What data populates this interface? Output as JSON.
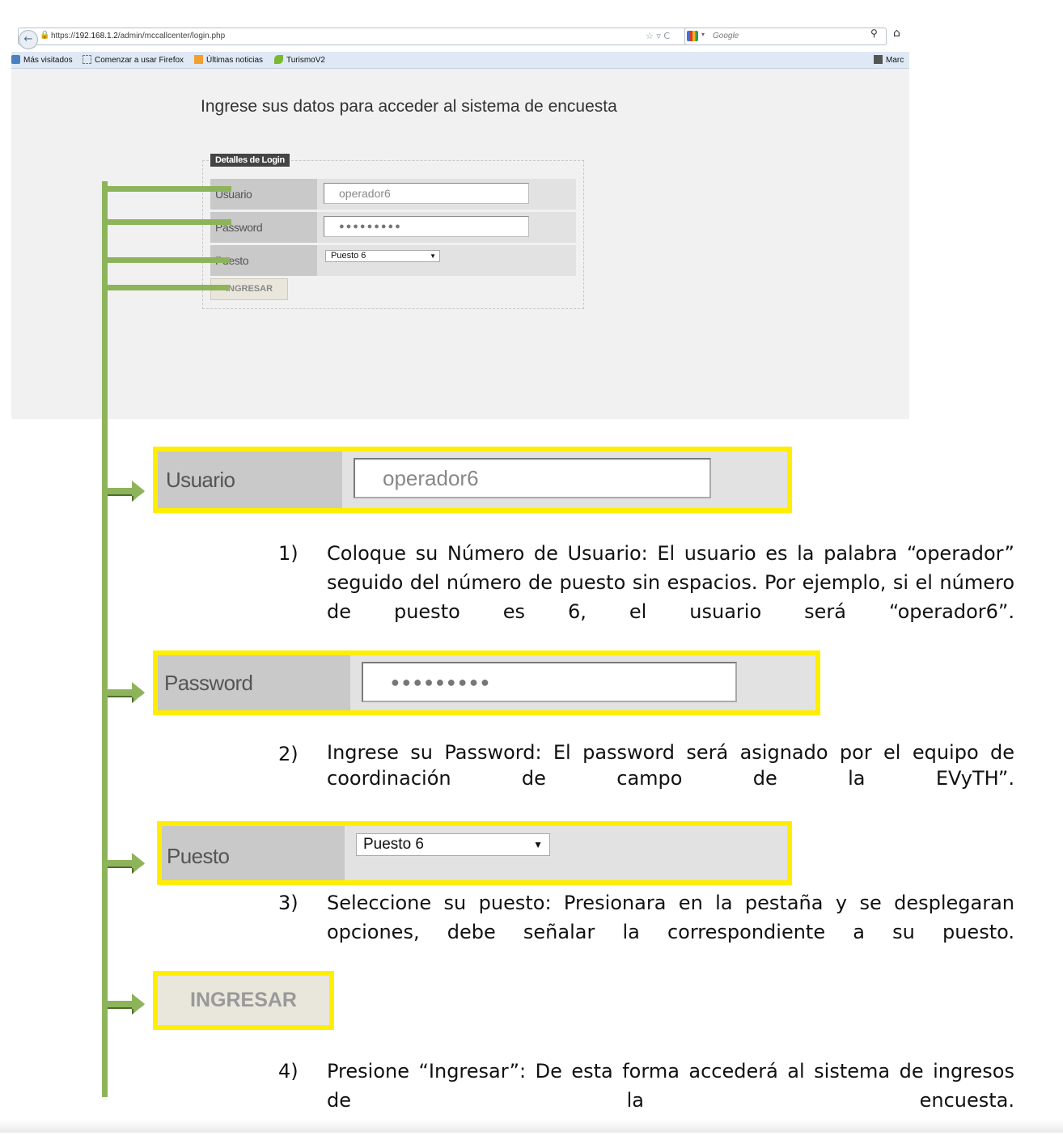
{
  "browser": {
    "url_prefix": "https://",
    "url_host": "192.168.1.2",
    "url_path": "/admin/mccallcenter/login.php",
    "search_placeholder": "Google",
    "bookmarks": [
      "Más visitados",
      "Comenzar a usar Firefox",
      "Últimas noticias",
      "TurismoV2"
    ],
    "bookmarks_right": "Marc"
  },
  "login": {
    "title": "Ingrese sus datos para acceder al sistema de encuesta",
    "legend": "Detalles de Login",
    "user_label": "Usuario",
    "user_value": "operador6",
    "password_label": "Password",
    "password_value": "●●●●●●●●●",
    "puesto_label": "Puesto",
    "puesto_value": "Puesto 6",
    "submit_label": "INGRESAR"
  },
  "steps": [
    {
      "num": "1)",
      "text": "Coloque su Número de Usuario: El usuario es la palabra “operador” seguido del número de puesto sin espacios. Por ejemplo, si el número de puesto es 6, el usuario será “operador6”."
    },
    {
      "num": "2)",
      "text": "Ingrese su Password: El password será asignado por el equipo de coordinación de campo de la EVyTH”."
    },
    {
      "num": "3)",
      "text": "Seleccione su puesto: Presionara en la pestaña y se desplegaran opciones, debe señalar la correspondiente a su puesto."
    },
    {
      "num": "4)",
      "text": "Presione “Ingresar”: De esta forma accederá al sistema de ingresos de la encuesta."
    }
  ],
  "colors": {
    "highlight": "#ffee00",
    "callout": "#8db45a"
  }
}
